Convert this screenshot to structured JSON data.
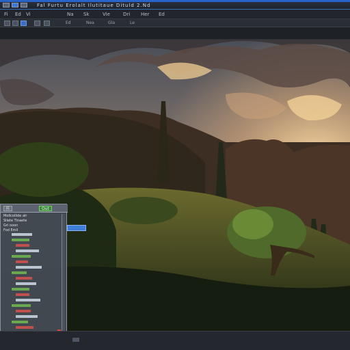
{
  "window": {
    "title": "Fal Furtu Erolalt Ilutitaue Dituld 2.Nd"
  },
  "menu": {
    "items": [
      "Fi",
      "Ed",
      "Vi",
      "Na",
      "Sk",
      "Vie",
      "Dri",
      "Her",
      "Ed"
    ]
  },
  "toolbar": {
    "labels": [
      "Ed",
      "Nea",
      "Gla",
      "Le"
    ]
  },
  "panel": {
    "tabs": [
      "Fi",
      "Out"
    ],
    "rows": [
      "Mollcollide alr",
      "Sliete Tinaete",
      "Gri ooon",
      "Fod Emll"
    ]
  },
  "colors": {
    "accent": "#2a63c7",
    "panel_tab_green": "#3c8a3c",
    "close_red": "#d9443f"
  }
}
